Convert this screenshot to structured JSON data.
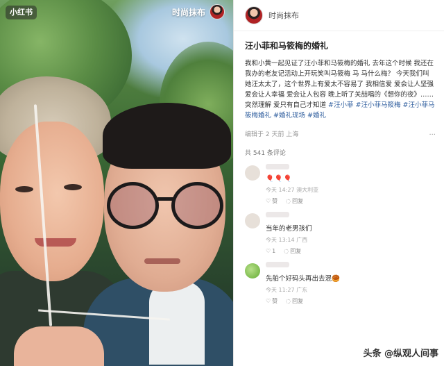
{
  "photo": {
    "logo": "小红书",
    "author_name": "时尚抹布"
  },
  "post": {
    "author_name": "时尚抹布",
    "title": "汪小菲和马筱梅的婚礼",
    "body_text": "我和小黄一起见证了汪小菲和马筱梅的婚礼 去年这个时候 我还在我办的老友记活动上开玩笑叫马筱梅 马 马什么梅？ 今天我们叫她汪太太了，这个世界上有爱太不容易了 我相信爱 爱会让人坚强 爱会让人幸福 爱会让人包容 晚上听了关喆唱的《想你的夜》……突然理解 爱只有自己才知道 ",
    "tags": [
      "#汪小菲",
      "#汪小菲马筱梅",
      "#汪小菲马筱梅婚礼",
      "#婚礼现场",
      "#婚礼"
    ],
    "edit_meta": "编辑于 2 天前 上海",
    "more_icon": "...",
    "comment_count": "共 541 条评论"
  },
  "comments": [
    {
      "text": "🎈🎈🎈",
      "meta": "今天 14:27 澳大利亚",
      "like_label": "赞",
      "reply_label": "回复",
      "like_count": ""
    },
    {
      "text": "当年的老男孩们",
      "meta": "今天 13:14 广西",
      "like_label": "",
      "reply_label": "回复",
      "like_count": "1"
    },
    {
      "text": "先舶个好码头再出去混🥮",
      "meta": "今天 11:27 广东",
      "like_label": "赞",
      "reply_label": "回复",
      "like_count": ""
    }
  ],
  "watermark": "头条 @纵观人间事",
  "colors": {
    "tag": "#2f5e9e",
    "text": "#333333",
    "muted": "#999999"
  }
}
